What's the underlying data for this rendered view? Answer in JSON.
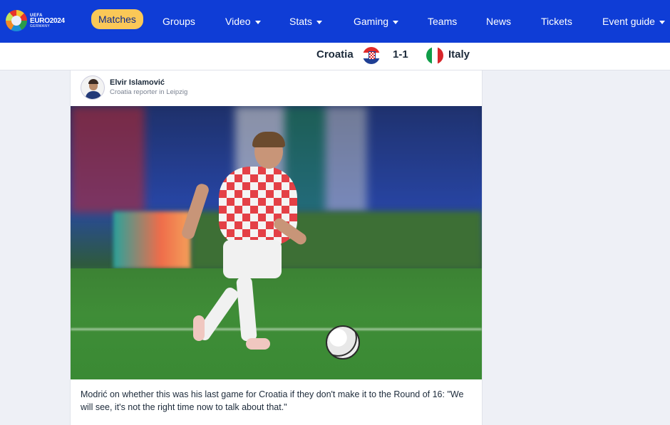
{
  "nav": {
    "logo": {
      "line1": "UEFA",
      "line2": "EURO2024",
      "line3": "GERMANY"
    },
    "items": [
      {
        "label": "Matches",
        "active": true,
        "dropdown": false
      },
      {
        "label": "Groups",
        "active": false,
        "dropdown": false
      },
      {
        "label": "Video",
        "active": false,
        "dropdown": true
      },
      {
        "label": "Stats",
        "active": false,
        "dropdown": true
      },
      {
        "label": "Gaming",
        "active": false,
        "dropdown": true
      },
      {
        "label": "Teams",
        "active": false,
        "dropdown": false
      },
      {
        "label": "News",
        "active": false,
        "dropdown": false
      },
      {
        "label": "Tickets",
        "active": false,
        "dropdown": false
      },
      {
        "label": "Event guide",
        "active": false,
        "dropdown": true
      }
    ],
    "colors": {
      "bar": "#0f3dd6",
      "active_pill": "#fbc857"
    }
  },
  "match": {
    "home_team": "Croatia",
    "away_team": "Italy",
    "score": "1-1",
    "home_flag_icon": "croatia-flag-icon",
    "away_flag_icon": "italy-flag-icon"
  },
  "post": {
    "author_name": "Elvir Islamović",
    "author_role": "Croatia reporter in Leipzig",
    "caption": "Modrić on whether this was his last game for Croatia if they don't make it to the Round of 16: \"We will see, it's not the right time now to talk about that.\""
  }
}
